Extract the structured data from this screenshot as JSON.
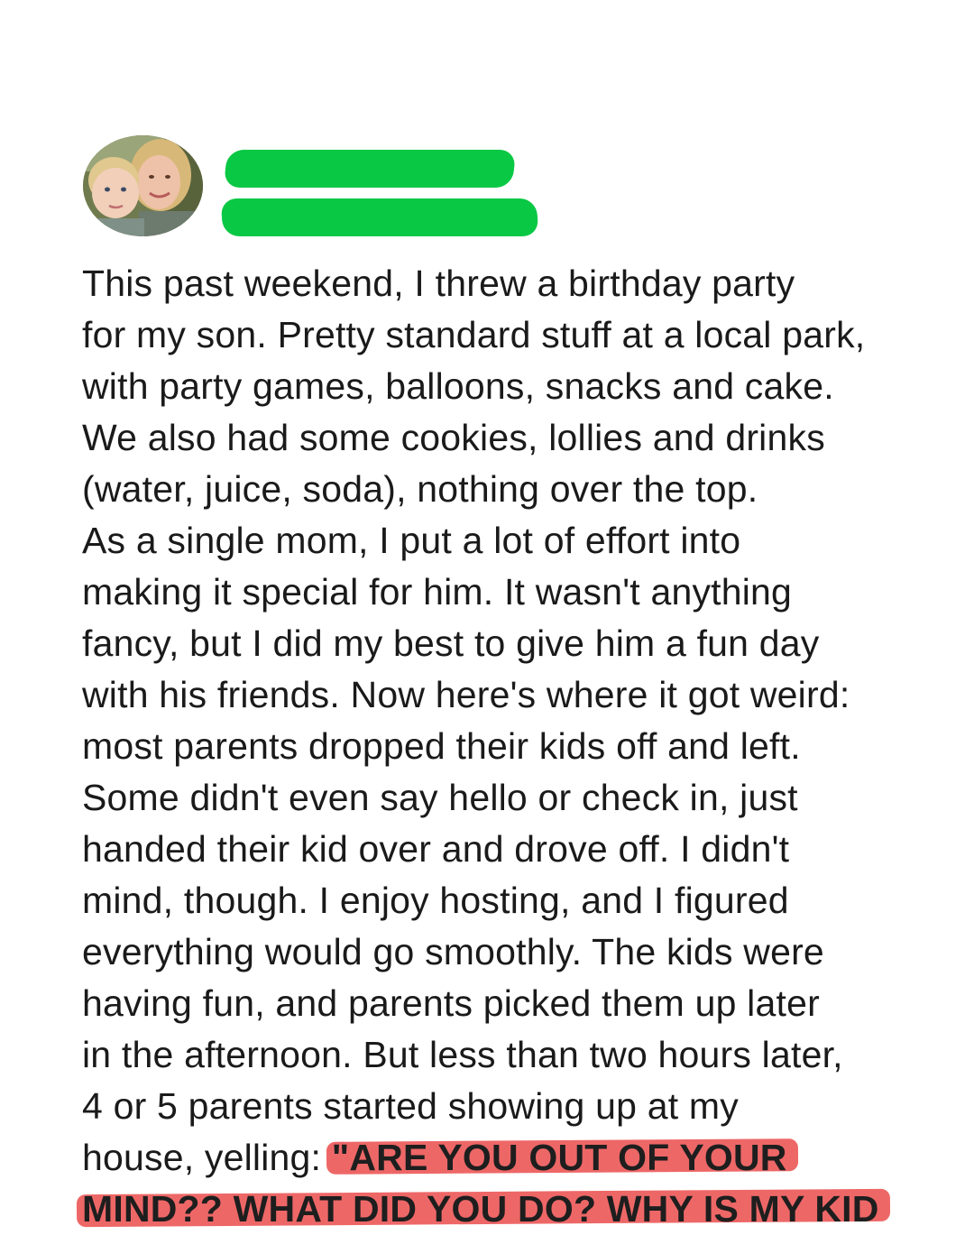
{
  "post": {
    "author": {
      "avatar_icon": "profile-photo-mother-and-son",
      "redaction_color": "#08c844"
    },
    "highlight_color": "#ee6767",
    "lines": [
      "This past weekend, I threw a birthday party",
      "for my son. Pretty standard stuff at a local park,",
      "with party games, balloons, snacks and cake.",
      "We also had some cookies, lollies and drinks",
      "(water, juice, soda), nothing over the top.",
      "As a single mom, I put a lot of effort into",
      "making it special for him. It wasn't anything",
      "fancy, but I did my best to give him a fun day",
      "with his friends. Now here's where it got weird:",
      "most parents dropped their kids off and left.",
      "Some didn't even say hello or check in, just",
      "handed their kid over and drove off. I didn't",
      "mind, though. I enjoy hosting, and I figured",
      "everything would go smoothly. The kids were",
      "having fun, and parents picked them up later",
      "in the afternoon. But less than two hours later,",
      "4 or 5 parents started showing up at my"
    ],
    "line_18_plain": "house, yelling: ",
    "line_18_highlight": "\"ARE YOU OUT OF YOUR",
    "line_19_highlight": "MIND?? WHAT DID YOU DO? WHY IS MY KID"
  }
}
